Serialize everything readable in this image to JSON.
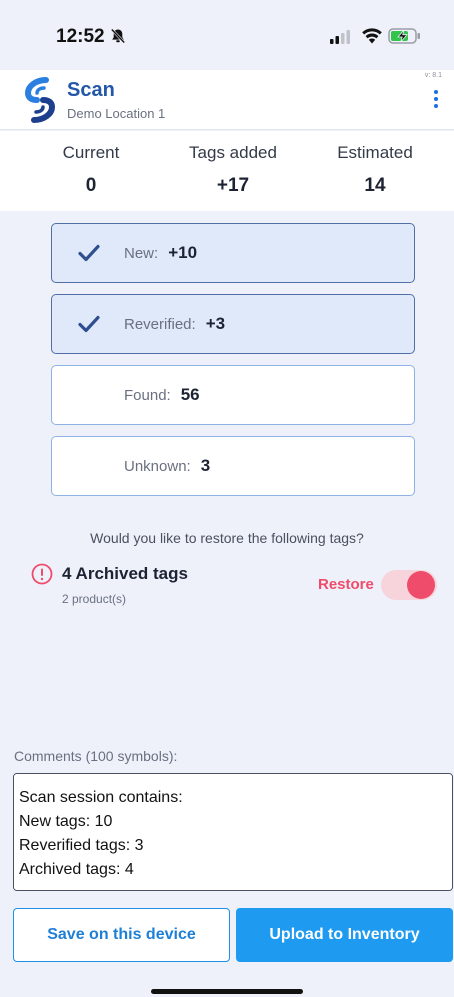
{
  "status_bar": {
    "time": "12:52",
    "icons": [
      "bell-slash-icon",
      "cellular-signal-icon",
      "wifi-icon",
      "battery-charging-icon"
    ]
  },
  "header": {
    "title": "Scan",
    "subtitle": "Demo Location 1",
    "version": "v: 8.1",
    "menu_icon": "kebab-menu-icon"
  },
  "stats": [
    {
      "label": "Current",
      "value": "0"
    },
    {
      "label": "Tags added",
      "value": "+17"
    },
    {
      "label": "Estimated",
      "value": "14"
    }
  ],
  "tag_rows": [
    {
      "label": "New:",
      "value": "+10",
      "checked": true
    },
    {
      "label": "Reverified:",
      "value": "+3",
      "checked": true
    },
    {
      "label": "Found:",
      "value": "56",
      "checked": false
    },
    {
      "label": "Unknown:",
      "value": "3",
      "checked": false
    }
  ],
  "restore": {
    "question": "Would you like to restore the following tags?",
    "archived_title": "4 Archived tags",
    "archived_sub": "2 product(s)",
    "label": "Restore",
    "enabled": true
  },
  "comments": {
    "label": "Comments (100 symbols):",
    "value": "Scan session contains:\nNew tags: 10\nReverified tags: 3\nArchived tags: 4"
  },
  "buttons": {
    "save": "Save on this device",
    "upload": "Upload to Inventory"
  },
  "colors": {
    "brand": "#2357a7",
    "accent": "#1e9af0",
    "restore": "#ef4c6b"
  }
}
